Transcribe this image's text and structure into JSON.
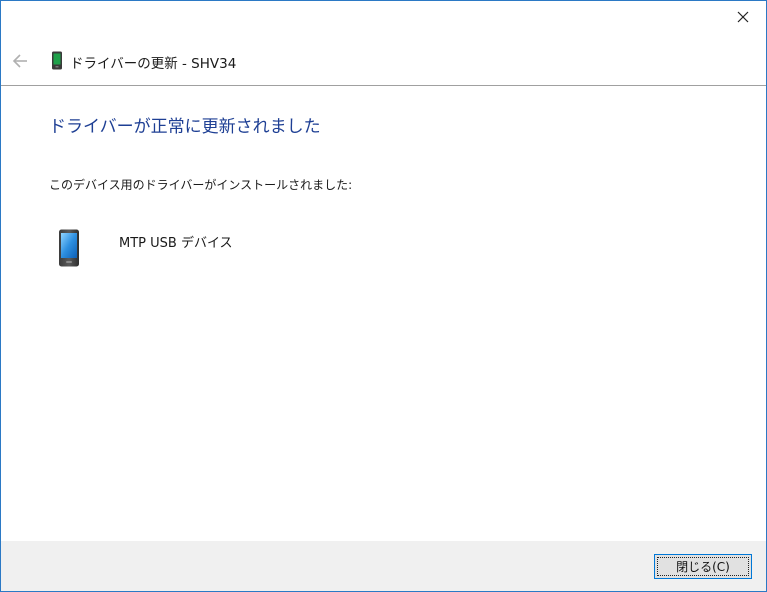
{
  "window": {
    "title": "ドライバーの更新 - SHV34",
    "close_icon": "close-icon",
    "back_icon": "back-arrow-icon",
    "title_icon": "phone-icon"
  },
  "main": {
    "heading": "ドライバーが正常に更新されました",
    "description": "このデバイス用のドライバーがインストールされました:",
    "device": {
      "icon": "phone-icon",
      "name": "MTP USB デバイス"
    }
  },
  "footer": {
    "close_button_label": "閉じる(C)"
  },
  "colors": {
    "heading": "#1e3f94",
    "window_border": "#2b79c5",
    "footer_bg": "#f0f0f0",
    "button_border": "#0078d7"
  }
}
